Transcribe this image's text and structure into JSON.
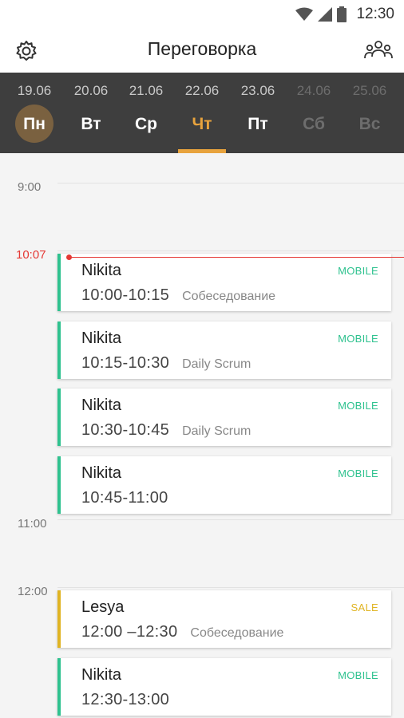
{
  "status_bar": {
    "time": "12:30",
    "icons": [
      "wifi-icon",
      "signal-icon",
      "battery-icon"
    ]
  },
  "app_bar": {
    "title": "Переговорка",
    "left_icon": "settings-icon",
    "right_icon": "people-icon"
  },
  "days": [
    {
      "date": "19.06",
      "name": "Пн",
      "state": "today"
    },
    {
      "date": "20.06",
      "name": "Вт",
      "state": "normal"
    },
    {
      "date": "21.06",
      "name": "Ср",
      "state": "normal"
    },
    {
      "date": "22.06",
      "name": "Чт",
      "state": "selected"
    },
    {
      "date": "23.06",
      "name": "Пт",
      "state": "normal"
    },
    {
      "date": "24.06",
      "name": "Сб",
      "state": "weekend"
    },
    {
      "date": "25.06",
      "name": "Вс",
      "state": "weekend"
    }
  ],
  "timeline": {
    "hours": [
      "9:00",
      "11:00",
      "12:00"
    ],
    "now": "10:07"
  },
  "events": [
    {
      "name": "Nikita",
      "time": "10:00-10:15",
      "subject": "Собеседование",
      "tag": "MOBILE"
    },
    {
      "name": "Nikita",
      "time": "10:15-10:30",
      "subject": "Daily Scrum",
      "tag": "MOBILE"
    },
    {
      "name": "Nikita",
      "time": "10:30-10:45",
      "subject": "Daily Scrum",
      "tag": "MOBILE"
    },
    {
      "name": "Nikita",
      "time": "10:45-11:00",
      "subject": "",
      "tag": "MOBILE"
    },
    {
      "name": "Lesya",
      "time": "12:00 –12:30",
      "subject": "Собеседование",
      "tag": "SALE"
    },
    {
      "name": "Nikita",
      "time": "12:30-13:00",
      "subject": "",
      "tag": "MOBILE"
    }
  ],
  "colors": {
    "accent": "#e8a33d",
    "mobile": "#2fc28f",
    "sale": "#e0b423",
    "now_line": "#e53935",
    "day_bar": "#3e3e3e"
  }
}
